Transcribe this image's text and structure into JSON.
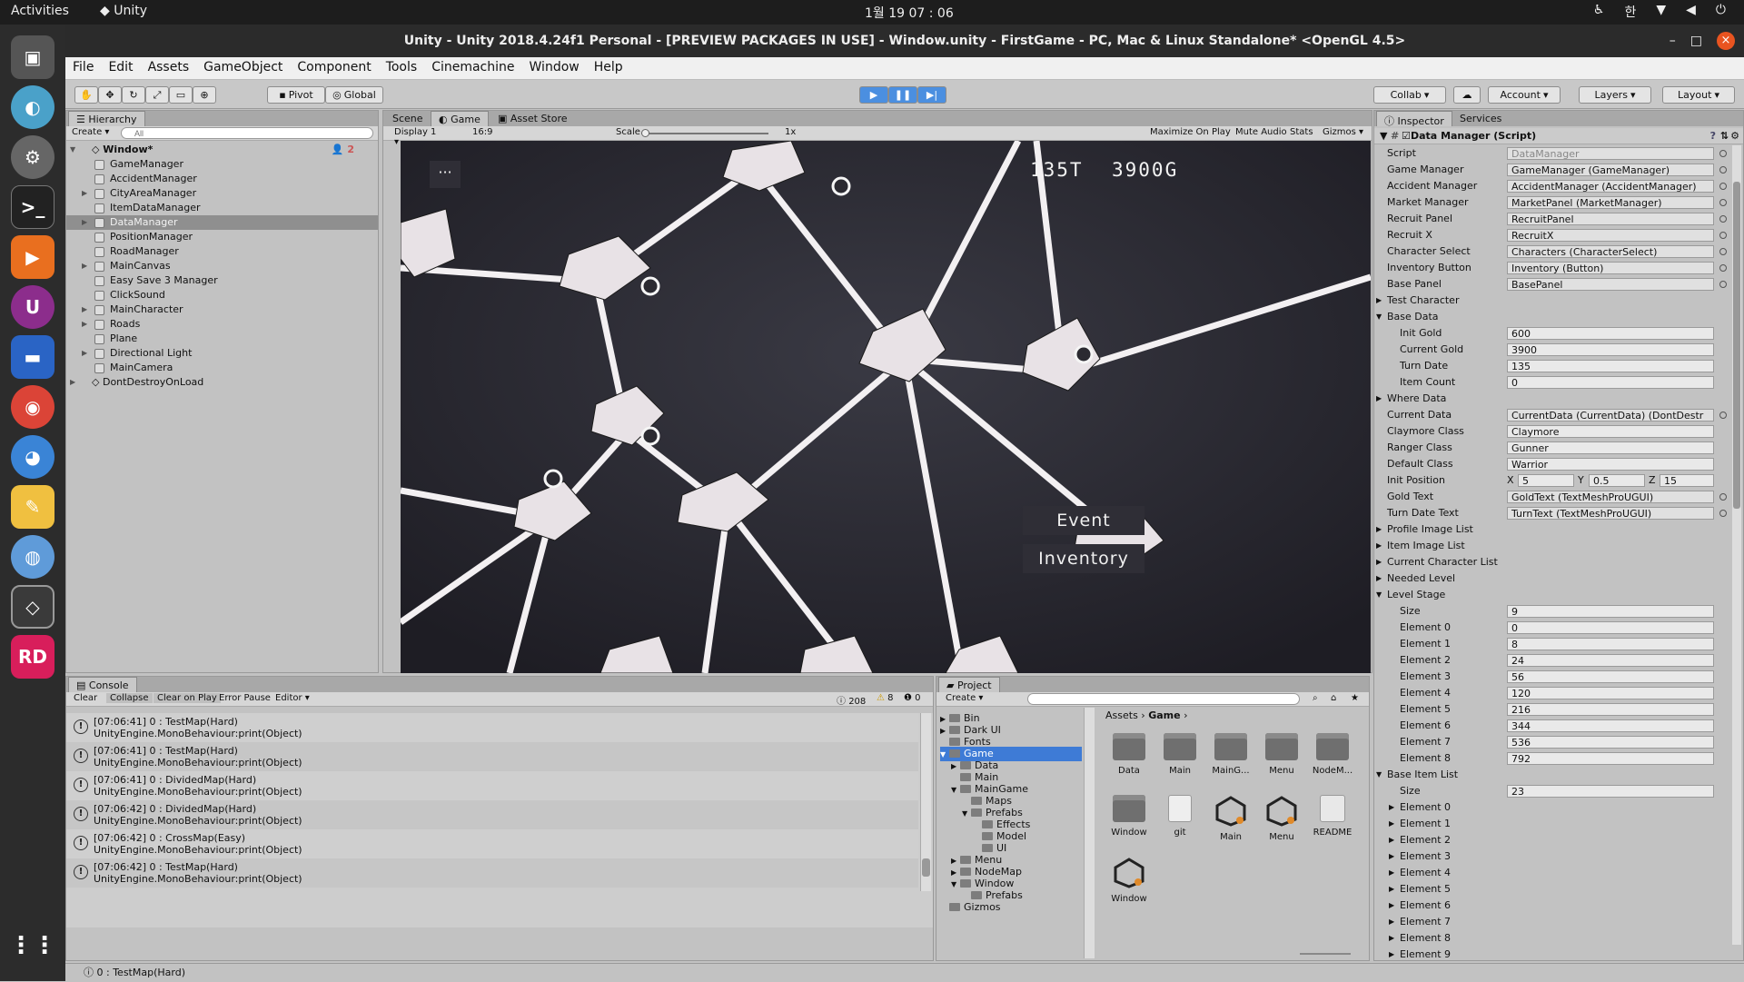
{
  "system": {
    "activities": "Activities",
    "app_name": "Unity",
    "clock": "1월 19 07 : 06",
    "input_method": "한"
  },
  "window": {
    "title": "Unity - Unity 2018.4.24f1 Personal - [PREVIEW PACKAGES IN USE] - Window.unity - FirstGame - PC, Mac & Linux Standalone* <OpenGL 4.5>"
  },
  "menu": [
    "File",
    "Edit",
    "Assets",
    "GameObject",
    "Component",
    "Tools",
    "Cinemachine",
    "Window",
    "Help"
  ],
  "toolbar": {
    "pivot": "Pivot",
    "global": "Global",
    "collab": "Collab",
    "account": "Account",
    "layers": "Layers",
    "layout": "Layout"
  },
  "hierarchy": {
    "tab": "Hierarchy",
    "create": "Create",
    "search_placeholder": "All",
    "scene": "Window*",
    "scene_count": "2",
    "items": [
      "GameManager",
      "AccidentManager",
      "CityAreaManager",
      "ItemDataManager",
      "DataManager",
      "PositionManager",
      "RoadManager",
      "MainCanvas",
      "Easy Save 3 Manager",
      "ClickSound",
      "MainCharacter",
      "Roads",
      "Plane",
      "Directional Light",
      "MainCamera"
    ],
    "dontdestroy": "DontDestroyOnLoad"
  },
  "game_view": {
    "tabs": [
      "Scene",
      "Game",
      "Asset Store"
    ],
    "display": "Display 1",
    "aspect": "16:9",
    "scale_label": "Scale",
    "scale_value": "1x",
    "options": [
      "Maximize On Play",
      "Mute Audio",
      "Stats",
      "Gizmos"
    ],
    "turn": "135T",
    "gold": "3900G",
    "event_btn": "Event",
    "inventory_btn": "Inventory",
    "menu_dots": "···"
  },
  "console": {
    "tab": "Console",
    "buttons": [
      "Clear",
      "Collapse",
      "Clear on Play",
      "Error Pause",
      "Editor"
    ],
    "count_log": "208",
    "count_warn": "8",
    "count_err": "0",
    "rows": [
      {
        "line1": "[07:06:41] 0 : TestMap(Hard)",
        "line2": "UnityEngine.MonoBehaviour:print(Object)"
      },
      {
        "line1": "[07:06:41] 0 : TestMap(Hard)",
        "line2": "UnityEngine.MonoBehaviour:print(Object)"
      },
      {
        "line1": "[07:06:41] 0 : DividedMap(Hard)",
        "line2": "UnityEngine.MonoBehaviour:print(Object)"
      },
      {
        "line1": "[07:06:42] 0 : DividedMap(Hard)",
        "line2": "UnityEngine.MonoBehaviour:print(Object)"
      },
      {
        "line1": "[07:06:42] 0 : CrossMap(Easy)",
        "line2": "UnityEngine.MonoBehaviour:print(Object)"
      },
      {
        "line1": "[07:06:42] 0 : TestMap(Hard)",
        "line2": "UnityEngine.MonoBehaviour:print(Object)"
      }
    ]
  },
  "project": {
    "tab": "Project",
    "create": "Create",
    "breadcrumb": [
      "Assets",
      "Game"
    ],
    "tree": [
      "Bin",
      "Dark UI",
      "Fonts",
      "Game",
      "Data",
      "Main",
      "MainGame",
      "Maps",
      "Prefabs",
      "Effects",
      "Model",
      "UI",
      "Menu",
      "NodeMap",
      "Window",
      "Prefabs",
      "Gizmos"
    ],
    "assets": [
      "Data",
      "Main",
      "MainG...",
      "Menu",
      "NodeM...",
      "Window",
      "git",
      "Main",
      "Menu",
      "README",
      "Window"
    ]
  },
  "inspector": {
    "tabs": [
      "Inspector",
      "Services"
    ],
    "component": "Data Manager (Script)",
    "rows": [
      {
        "label": "Script",
        "value": "DataManager"
      },
      {
        "label": "Game Manager",
        "value": "GameManager (GameManager)"
      },
      {
        "label": "Accident Manager",
        "value": "AccidentManager (AccidentManager)"
      },
      {
        "label": "Market Manager",
        "value": "MarketPanel (MarketManager)"
      },
      {
        "label": "Recruit Panel",
        "value": "RecruitPanel"
      },
      {
        "label": "Recruit X",
        "value": "RecruitX"
      },
      {
        "label": "Character Select",
        "value": "Characters (CharacterSelect)"
      },
      {
        "label": "Inventory Button",
        "value": "Inventory (Button)"
      },
      {
        "label": "Base Panel",
        "value": "BasePanel"
      }
    ],
    "test_character": "Test Character",
    "base_data": "Base Data",
    "base_rows": [
      {
        "label": "Init Gold",
        "value": "600"
      },
      {
        "label": "Current Gold",
        "value": "3900"
      },
      {
        "label": "Turn Date",
        "value": "135"
      },
      {
        "label": "Item Count",
        "value": "0"
      }
    ],
    "where_data": "Where Data",
    "rows2": [
      {
        "label": "Current Data",
        "value": "CurrentData (CurrentData) (DontDestr"
      },
      {
        "label": "Claymore Class",
        "value": "Claymore"
      },
      {
        "label": "Ranger Class",
        "value": "Gunner"
      },
      {
        "label": "Default Class",
        "value": "Warrior"
      }
    ],
    "init_position": {
      "label": "Init Position",
      "x": "5",
      "y": "0.5",
      "z": "15"
    },
    "rows3": [
      {
        "label": "Gold Text",
        "value": "GoldText (TextMeshProUGUI)"
      },
      {
        "label": "Turn Date Text",
        "value": "TurnText (TextMeshProUGUI)"
      }
    ],
    "foldouts": [
      "Profile Image List",
      "Item Image List",
      "Current Character List",
      "Needed Level"
    ],
    "level_stage": "Level Stage",
    "level_size_label": "Size",
    "level_size": "9",
    "level_elements": [
      "0",
      "8",
      "24",
      "56",
      "120",
      "216",
      "344",
      "536",
      "792"
    ],
    "base_item_list": "Base Item List",
    "base_item_size": "23",
    "base_item_elements": [
      "Element 0",
      "Element 1",
      "Element 2",
      "Element 3",
      "Element 4",
      "Element 5",
      "Element 6",
      "Element 7",
      "Element 8",
      "Element 9"
    ]
  },
  "status": "0 : TestMap(Hard)"
}
